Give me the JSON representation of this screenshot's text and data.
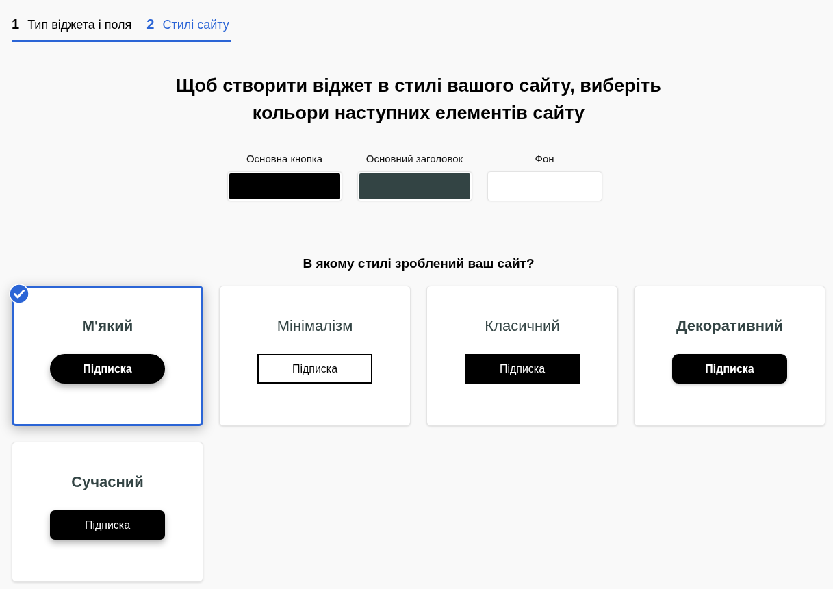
{
  "steps": [
    {
      "number": "1",
      "label": "Тип віджета і поля",
      "selected": false
    },
    {
      "number": "2",
      "label": "Стилі сайту",
      "selected": true
    }
  ],
  "heading": "Щоб створити віджет в стилі вашого сайту, виберіть\nкольори наступних елементів сайту",
  "colors": [
    {
      "label": "Основна кнопка",
      "color": "#000000"
    },
    {
      "label": "Основний заголовок",
      "color": "#334444"
    },
    {
      "label": "Фон",
      "color": "#ffffff"
    }
  ],
  "style_question": "В якому стилі зроблений ваш сайт?",
  "styles": [
    {
      "kind": "soft",
      "title": "М'який",
      "button": "Підписка",
      "selected": true
    },
    {
      "kind": "minimal",
      "title": "Мінімалізм",
      "button": "Підписка",
      "selected": false
    },
    {
      "kind": "classic",
      "title": "Класичний",
      "button": "Підписка",
      "selected": false
    },
    {
      "kind": "decorative",
      "title": "Декоративний",
      "button": "Підписка",
      "selected": false
    },
    {
      "kind": "modern",
      "title": "Сучасний",
      "button": "Підписка",
      "selected": false
    }
  ]
}
